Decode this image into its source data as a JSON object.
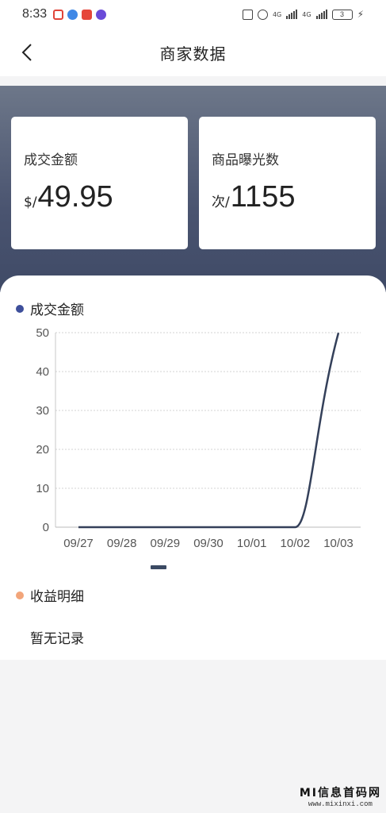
{
  "status": {
    "time": "8:33",
    "net1": "4G",
    "net2": "4G",
    "battery": "3"
  },
  "nav": {
    "title": "商家数据"
  },
  "stats": [
    {
      "label": "成交金额",
      "unit": "$/",
      "value": "49.95"
    },
    {
      "label": "商品曝光数",
      "unit": "次/",
      "value": "1155"
    }
  ],
  "chart_section": {
    "title": "成交金额",
    "dot_color": "#3e4f9b"
  },
  "chart_data": {
    "type": "line",
    "title": "",
    "xlabel": "",
    "ylabel": "",
    "categories": [
      "09/27",
      "09/28",
      "09/29",
      "09/30",
      "10/01",
      "10/02",
      "10/03"
    ],
    "values": [
      0,
      0,
      0,
      0,
      0,
      0,
      49.95
    ],
    "ylim": [
      0,
      50
    ],
    "yticks": [
      "0",
      "10",
      "20",
      "30",
      "40",
      "50"
    ],
    "grid": true,
    "line_color": "#34405a"
  },
  "income_section": {
    "title": "收益明细",
    "dot_color": "#f2a57a",
    "empty_text": "暂无记录"
  },
  "watermark": {
    "title": "MI信息首码网",
    "url": "www.mixinxi.com"
  }
}
